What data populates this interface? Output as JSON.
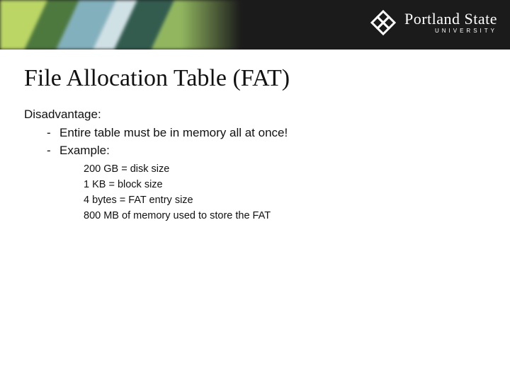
{
  "brand": {
    "name": "Portland State",
    "sub": "UNIVERSITY"
  },
  "title": "File Allocation Table (FAT)",
  "subhead": "Disadvantage:",
  "bullets": [
    "Entire table must be in memory all at once!",
    "Example:"
  ],
  "example": [
    "200 GB = disk size",
    "1 KB = block size",
    "4 bytes = FAT entry size",
    "800 MB of memory used to store the FAT"
  ]
}
